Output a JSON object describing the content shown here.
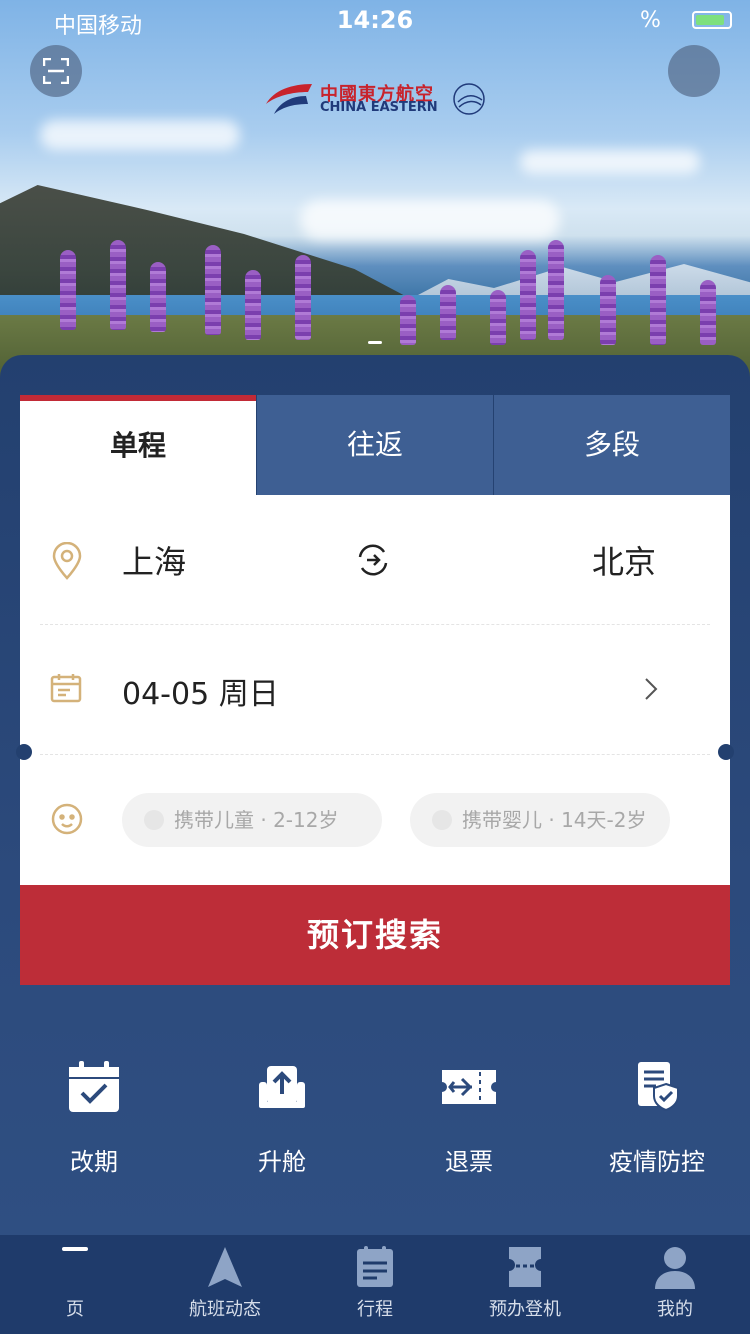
{
  "status_bar": {
    "carrier": "中国移动",
    "time": "14:26",
    "battery": "%"
  },
  "header": {
    "logo_cn": "中國東方航空",
    "logo_en": "CHINA EASTERN",
    "skyteam": "SKYTEAM"
  },
  "tabs": [
    {
      "label": "单程",
      "active": true
    },
    {
      "label": "往返",
      "active": false
    },
    {
      "label": "多段",
      "active": false
    }
  ],
  "route": {
    "from": "上海",
    "to": "北京"
  },
  "date": {
    "value": "04-05 周日"
  },
  "options": {
    "child": "携带儿童 · 2-12岁",
    "infant": "携带婴儿 · 14天-2岁"
  },
  "search_button": "预订搜索",
  "quick_actions": [
    {
      "label": "改期",
      "icon": "calendar-check-icon"
    },
    {
      "label": "升舱",
      "icon": "seat-upgrade-icon"
    },
    {
      "label": "退票",
      "icon": "ticket-refund-icon"
    },
    {
      "label": "疫情防控",
      "icon": "shield-document-icon"
    }
  ],
  "bottom_nav": [
    {
      "label": "页",
      "icon": "home-icon"
    },
    {
      "label": "航班动态",
      "icon": "flight-status-icon"
    },
    {
      "label": "行程",
      "icon": "itinerary-icon"
    },
    {
      "label": "预办登机",
      "icon": "checkin-icon"
    },
    {
      "label": "我的",
      "icon": "profile-icon"
    }
  ],
  "colors": {
    "brand_red": "#bd2d38",
    "panel_navy": "#2c4a7c",
    "nav_navy": "#1f3b6b",
    "icon_gold": "#d4b27a"
  }
}
